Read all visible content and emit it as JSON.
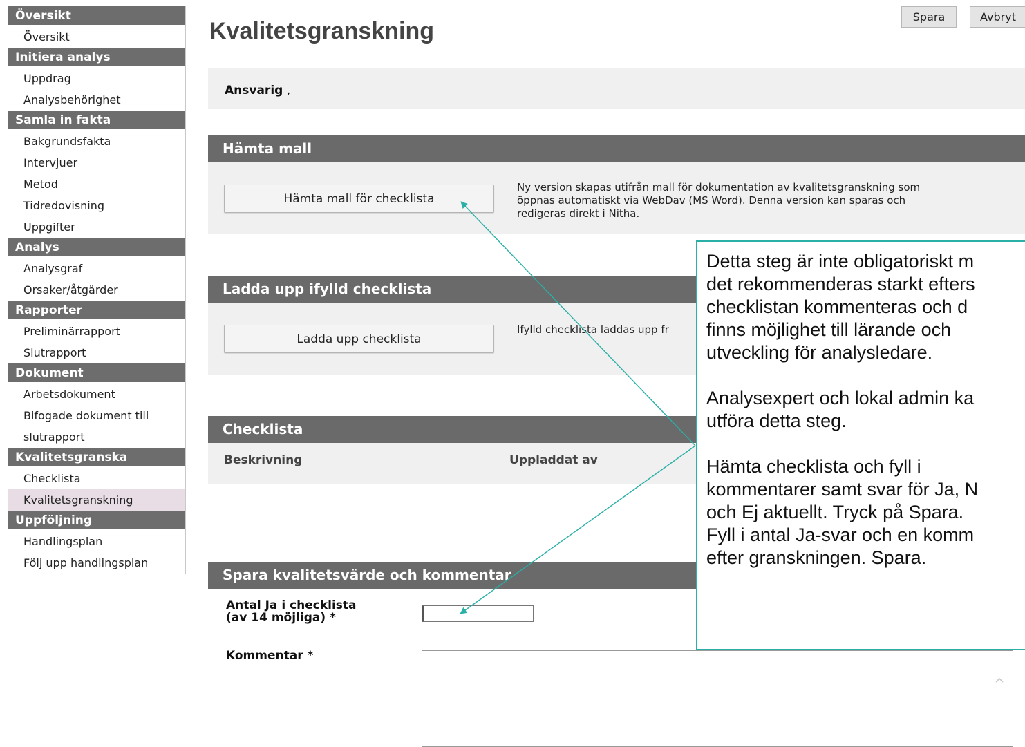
{
  "sidebar": {
    "sections": [
      {
        "title": "Översikt",
        "items": [
          "Översikt"
        ]
      },
      {
        "title": "Initiera analys",
        "items": [
          "Uppdrag",
          "Analysbehörighet"
        ]
      },
      {
        "title": "Samla in fakta",
        "items": [
          "Bakgrundsfakta",
          "Intervjuer",
          "Metod",
          "Tidredovisning",
          "Uppgifter"
        ]
      },
      {
        "title": "Analys",
        "items": [
          "Analysgraf",
          "Orsaker/åtgärder"
        ]
      },
      {
        "title": "Rapporter",
        "items": [
          "Preliminärrapport",
          "Slutrapport"
        ]
      },
      {
        "title": "Dokument",
        "items": [
          "Arbetsdokument",
          "Bifogade dokument till",
          "slutrapport"
        ]
      },
      {
        "title": "Kvalitetsgranska",
        "items": [
          "Checklista",
          "Kvalitetsgranskning"
        ]
      },
      {
        "title": "Uppföljning",
        "items": [
          "Handlingsplan",
          "Följ upp handlingsplan"
        ]
      }
    ],
    "active_item": "Kvalitetsgranskning"
  },
  "header": {
    "title": "Kvalitetsgranskning",
    "save_label": "Spara",
    "cancel_label": "Avbryt"
  },
  "responsible": {
    "label": "Ansvarig",
    "value": " ,"
  },
  "template_panel": {
    "title": "Hämta mall",
    "button_label": "Hämta mall för checklista",
    "description": "Ny version skapas utifrån mall för dokumentation av kvalitetsgranskning som\nöppnas automatiskt via WebDav (MS Word). Denna version kan sparas och\nredigeras direkt i Nitha."
  },
  "upload_panel": {
    "title": "Ladda upp ifylld checklista",
    "button_label": "Ladda upp checklista",
    "description": "Ifylld checklista laddas upp fr"
  },
  "checklist_panel": {
    "title": "Checklista",
    "columns": [
      "Beskrivning",
      "Uppladdat av"
    ]
  },
  "save_panel": {
    "title": "Spara kvalitetsvärde och kommentar",
    "count_label": "Antal Ja i checklista\n(av 14 möjliga) *",
    "count_value": "",
    "comment_label": "Kommentar *",
    "comment_value": ""
  },
  "callout": {
    "lines": [
      "Detta steg är inte obligatoriskt m",
      "det rekommenderas starkt efters",
      "checklistan kommenteras och d",
      "finns möjlighet till lärande och",
      "utveckling för analysledare.",
      "Analysexpert och lokal admin ka",
      "utföra detta steg.",
      "Hämta checklista och fyll i",
      "kommentarer samt svar för Ja, N",
      "och Ej aktuellt. Tryck på Spara.",
      "Fyll i antal Ja-svar och en komm",
      "efter granskningen. Spara."
    ]
  },
  "colors": {
    "section_header": "#6d6d6d",
    "panel_header": "#6a6a6a",
    "panel_bg": "#f0f0f0",
    "active_item": "#e8dde4",
    "callout_border": "#2ab0a6"
  }
}
